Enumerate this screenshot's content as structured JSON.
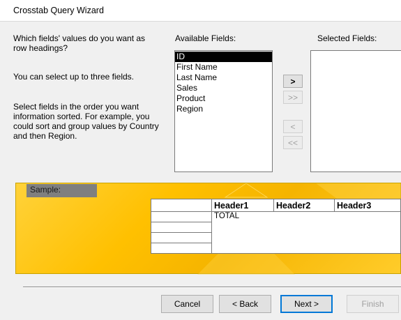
{
  "window": {
    "title": "Crosstab Query Wizard"
  },
  "instructions": {
    "question": "Which fields' values do you want as row headings?",
    "limit": "You can select up to three fields.",
    "order": "Select fields in the order you want information sorted.  For example, you could sort and group values by Country and then Region."
  },
  "available": {
    "label": "Available Fields:",
    "items": [
      "ID",
      "First Name",
      "Last Name",
      "Sales",
      "Product",
      "Region"
    ],
    "selected_item": "ID"
  },
  "selected": {
    "label": "Selected Fields:",
    "items": []
  },
  "move_buttons": {
    "add_one": ">",
    "add_all": ">>",
    "remove_one": "<",
    "remove_all": "<<"
  },
  "sample": {
    "label": "Sample:",
    "headers": [
      "Header1",
      "Header2",
      "Header3"
    ],
    "total_label": "TOTAL"
  },
  "buttons": {
    "cancel": "Cancel",
    "back": "< Back",
    "next": "Next >",
    "finish": "Finish"
  }
}
